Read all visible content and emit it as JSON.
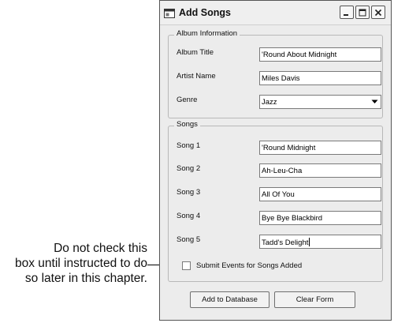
{
  "window": {
    "title": "Add Songs"
  },
  "album_info": {
    "group_title": "Album Information",
    "album_title_label": "Album Title",
    "album_title_value": "'Round About Midnight",
    "artist_name_label": "Artist Name",
    "artist_name_value": "Miles Davis",
    "genre_label": "Genre",
    "genre_value": "Jazz"
  },
  "songs": {
    "group_title": "Songs",
    "items": [
      {
        "label": "Song 1",
        "value": "'Round Midnight"
      },
      {
        "label": "Song 2",
        "value": "Ah-Leu-Cha"
      },
      {
        "label": "Song 3",
        "value": "All Of You"
      },
      {
        "label": "Song 4",
        "value": "Bye Bye Blackbird"
      },
      {
        "label": "Song 5",
        "value": "Tadd's Delight"
      }
    ]
  },
  "options": {
    "submit_events_label": "Submit Events for Songs Added",
    "submit_events_checked": false
  },
  "actions": {
    "add_label": "Add to Database",
    "clear_label": "Clear Form"
  },
  "annotation": {
    "lines": [
      "Do not check this",
      "box until instructed to do",
      "so later in this chapter."
    ]
  },
  "icons": {
    "app": "form-window-icon",
    "minimize": "minimize-icon",
    "maximize": "maximize-icon",
    "close": "close-icon",
    "dropdown": "chevron-down-icon"
  }
}
